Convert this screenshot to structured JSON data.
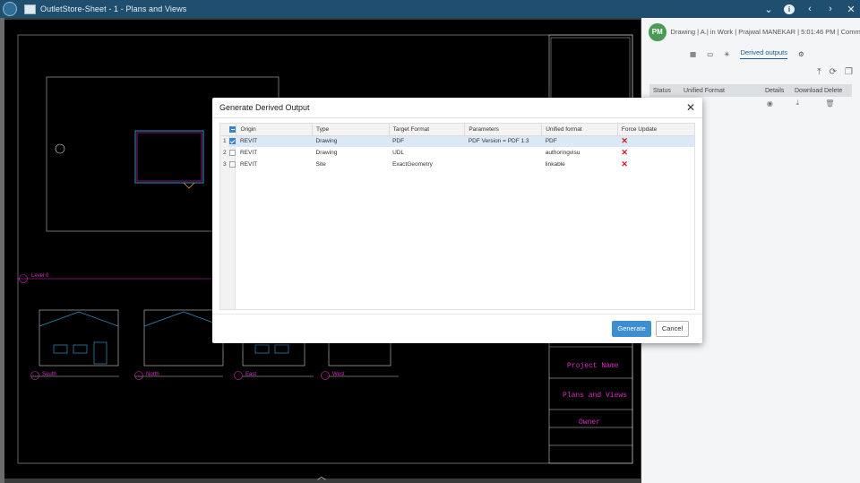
{
  "app": {
    "window_title": "OutletStore-Sheet - 1 - Plans and Views"
  },
  "right_panel": {
    "avatar_initials": "PM",
    "meta": "Drawing | A.| in Work | Prajwal MANEKAR | 5:01:46 PM | Commo",
    "active_tab": "Derived outputs",
    "table_headers": [
      "Status",
      "Unified Format",
      "Details",
      "Download",
      "Delete"
    ]
  },
  "drawing": {
    "level_label": "Level 0",
    "elevations": [
      "South",
      "North",
      "East",
      "West"
    ],
    "titleblock": {
      "project_name": "Project Name",
      "sheet_name": "Plans and Views",
      "owner": "Owner"
    }
  },
  "modal": {
    "title": "Generate Derived Output",
    "columns": [
      "Origin",
      "Type",
      "Target Format",
      "Parameters",
      "Unified format",
      "Force Update"
    ],
    "rows": [
      {
        "num": "1",
        "checked": true,
        "origin": "REVIT",
        "type": "Drawing",
        "target": "PDF",
        "params": "PDF Version = PDF 1.3",
        "unified": "PDF"
      },
      {
        "num": "2",
        "checked": false,
        "origin": "REVIT",
        "type": "Drawing",
        "target": "UDL",
        "params": "",
        "unified": "authoringvisu"
      },
      {
        "num": "3",
        "checked": false,
        "origin": "REVIT",
        "type": "Site",
        "target": "ExactGeometry",
        "params": "",
        "unified": "linkable"
      }
    ],
    "force_update_icon": "close-x-icon",
    "generate_label": "Generate",
    "cancel_label": "Cancel"
  },
  "colors": {
    "titlebar": "#1f4e6e",
    "accent": "#3d8ed0",
    "selected_row": "#dbe9f6",
    "drawing_lines": "#e02cc8"
  }
}
